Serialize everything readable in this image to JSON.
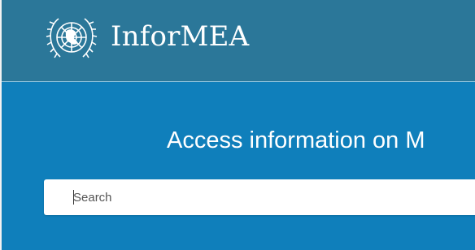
{
  "header": {
    "brand_name": "InforMEA",
    "logo_icon": "un-emblem-icon",
    "background": "#2b7799"
  },
  "hero": {
    "title": "Access information on M",
    "background": "#0f7fbb"
  },
  "search": {
    "placeholder": "Search",
    "value": ""
  }
}
